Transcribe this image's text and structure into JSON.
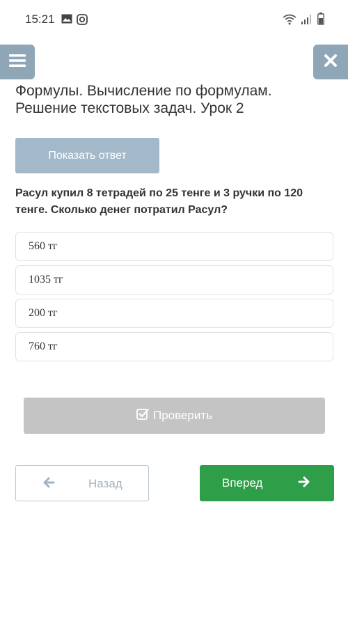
{
  "status_bar": {
    "time": "15:21",
    "icons": [
      "image-icon",
      "instagram-icon",
      "wifi-icon",
      "signal-icon",
      "battery-icon"
    ]
  },
  "header": {
    "menu_icon": "hamburger-menu-icon",
    "close_icon": "close-x-icon",
    "title": "Формулы. Вычисление по формулам. Решение текстовых задач. Урок 2"
  },
  "show_answer_label": "Показать ответ",
  "question": "Расул купил 8 тетрадей по 25 тенге и 3 ручки по 120 тенге. Сколько денег потратил Расул?",
  "options": [
    "560 тг",
    "1035 тг",
    "200 тг",
    "760 тг"
  ],
  "check_label": "Проверить",
  "nav": {
    "back_label": "Назад",
    "next_label": "Вперед"
  },
  "colors": {
    "header_button": "#8ea6b6",
    "show_answer": "#a3b9c9",
    "check_disabled": "#c4c4c4",
    "next_button": "#2e9e48"
  }
}
